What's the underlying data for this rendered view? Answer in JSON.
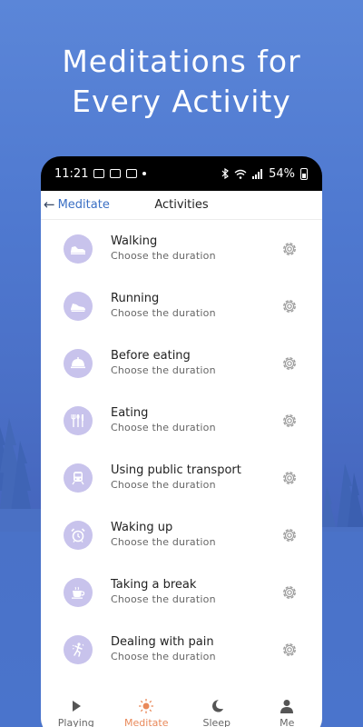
{
  "promo": {
    "line1": "Meditations for",
    "line2": "Every Activity"
  },
  "status_bar": {
    "time": "11:21",
    "battery": "54%"
  },
  "header": {
    "back_label": "Meditate",
    "title": "Activities"
  },
  "activities": [
    {
      "title": "Walking",
      "subtitle": "Choose the duration",
      "icon": "walking-shoe-icon"
    },
    {
      "title": "Running",
      "subtitle": "Choose the duration",
      "icon": "running-shoe-icon"
    },
    {
      "title": "Before eating",
      "subtitle": "Choose the duration",
      "icon": "food-cloche-icon"
    },
    {
      "title": "Eating",
      "subtitle": "Choose the duration",
      "icon": "cutlery-icon"
    },
    {
      "title": "Using public transport",
      "subtitle": "Choose the duration",
      "icon": "train-icon"
    },
    {
      "title": "Waking up",
      "subtitle": "Choose the duration",
      "icon": "alarm-clock-icon"
    },
    {
      "title": "Taking a break",
      "subtitle": "Choose the duration",
      "icon": "coffee-cup-icon"
    },
    {
      "title": "Dealing with pain",
      "subtitle": "Choose the duration",
      "icon": "pain-figure-icon"
    }
  ],
  "tabs": [
    {
      "label": "Playing",
      "icon": "play-icon"
    },
    {
      "label": "Meditate",
      "icon": "sun-icon",
      "active": true
    },
    {
      "label": "Sleep",
      "icon": "moon-icon"
    },
    {
      "label": "Me",
      "icon": "person-icon"
    }
  ],
  "colors": {
    "background": "#4f79d0",
    "icon_circle": "#c8c3ec",
    "active_tab": "#e9895a",
    "link": "#3a6fc4"
  }
}
